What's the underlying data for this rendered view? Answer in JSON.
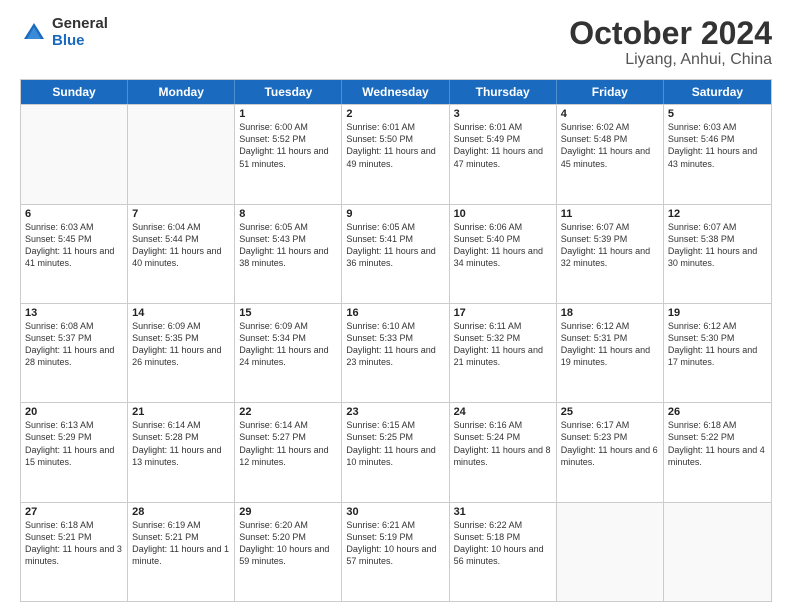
{
  "logo": {
    "general": "General",
    "blue": "Blue"
  },
  "header": {
    "month": "October 2024",
    "location": "Liyang, Anhui, China"
  },
  "weekdays": [
    "Sunday",
    "Monday",
    "Tuesday",
    "Wednesday",
    "Thursday",
    "Friday",
    "Saturday"
  ],
  "rows": [
    [
      {
        "day": "",
        "info": ""
      },
      {
        "day": "",
        "info": ""
      },
      {
        "day": "1",
        "info": "Sunrise: 6:00 AM\nSunset: 5:52 PM\nDaylight: 11 hours and 51 minutes."
      },
      {
        "day": "2",
        "info": "Sunrise: 6:01 AM\nSunset: 5:50 PM\nDaylight: 11 hours and 49 minutes."
      },
      {
        "day": "3",
        "info": "Sunrise: 6:01 AM\nSunset: 5:49 PM\nDaylight: 11 hours and 47 minutes."
      },
      {
        "day": "4",
        "info": "Sunrise: 6:02 AM\nSunset: 5:48 PM\nDaylight: 11 hours and 45 minutes."
      },
      {
        "day": "5",
        "info": "Sunrise: 6:03 AM\nSunset: 5:46 PM\nDaylight: 11 hours and 43 minutes."
      }
    ],
    [
      {
        "day": "6",
        "info": "Sunrise: 6:03 AM\nSunset: 5:45 PM\nDaylight: 11 hours and 41 minutes."
      },
      {
        "day": "7",
        "info": "Sunrise: 6:04 AM\nSunset: 5:44 PM\nDaylight: 11 hours and 40 minutes."
      },
      {
        "day": "8",
        "info": "Sunrise: 6:05 AM\nSunset: 5:43 PM\nDaylight: 11 hours and 38 minutes."
      },
      {
        "day": "9",
        "info": "Sunrise: 6:05 AM\nSunset: 5:41 PM\nDaylight: 11 hours and 36 minutes."
      },
      {
        "day": "10",
        "info": "Sunrise: 6:06 AM\nSunset: 5:40 PM\nDaylight: 11 hours and 34 minutes."
      },
      {
        "day": "11",
        "info": "Sunrise: 6:07 AM\nSunset: 5:39 PM\nDaylight: 11 hours and 32 minutes."
      },
      {
        "day": "12",
        "info": "Sunrise: 6:07 AM\nSunset: 5:38 PM\nDaylight: 11 hours and 30 minutes."
      }
    ],
    [
      {
        "day": "13",
        "info": "Sunrise: 6:08 AM\nSunset: 5:37 PM\nDaylight: 11 hours and 28 minutes."
      },
      {
        "day": "14",
        "info": "Sunrise: 6:09 AM\nSunset: 5:35 PM\nDaylight: 11 hours and 26 minutes."
      },
      {
        "day": "15",
        "info": "Sunrise: 6:09 AM\nSunset: 5:34 PM\nDaylight: 11 hours and 24 minutes."
      },
      {
        "day": "16",
        "info": "Sunrise: 6:10 AM\nSunset: 5:33 PM\nDaylight: 11 hours and 23 minutes."
      },
      {
        "day": "17",
        "info": "Sunrise: 6:11 AM\nSunset: 5:32 PM\nDaylight: 11 hours and 21 minutes."
      },
      {
        "day": "18",
        "info": "Sunrise: 6:12 AM\nSunset: 5:31 PM\nDaylight: 11 hours and 19 minutes."
      },
      {
        "day": "19",
        "info": "Sunrise: 6:12 AM\nSunset: 5:30 PM\nDaylight: 11 hours and 17 minutes."
      }
    ],
    [
      {
        "day": "20",
        "info": "Sunrise: 6:13 AM\nSunset: 5:29 PM\nDaylight: 11 hours and 15 minutes."
      },
      {
        "day": "21",
        "info": "Sunrise: 6:14 AM\nSunset: 5:28 PM\nDaylight: 11 hours and 13 minutes."
      },
      {
        "day": "22",
        "info": "Sunrise: 6:14 AM\nSunset: 5:27 PM\nDaylight: 11 hours and 12 minutes."
      },
      {
        "day": "23",
        "info": "Sunrise: 6:15 AM\nSunset: 5:25 PM\nDaylight: 11 hours and 10 minutes."
      },
      {
        "day": "24",
        "info": "Sunrise: 6:16 AM\nSunset: 5:24 PM\nDaylight: 11 hours and 8 minutes."
      },
      {
        "day": "25",
        "info": "Sunrise: 6:17 AM\nSunset: 5:23 PM\nDaylight: 11 hours and 6 minutes."
      },
      {
        "day": "26",
        "info": "Sunrise: 6:18 AM\nSunset: 5:22 PM\nDaylight: 11 hours and 4 minutes."
      }
    ],
    [
      {
        "day": "27",
        "info": "Sunrise: 6:18 AM\nSunset: 5:21 PM\nDaylight: 11 hours and 3 minutes."
      },
      {
        "day": "28",
        "info": "Sunrise: 6:19 AM\nSunset: 5:21 PM\nDaylight: 11 hours and 1 minute."
      },
      {
        "day": "29",
        "info": "Sunrise: 6:20 AM\nSunset: 5:20 PM\nDaylight: 10 hours and 59 minutes."
      },
      {
        "day": "30",
        "info": "Sunrise: 6:21 AM\nSunset: 5:19 PM\nDaylight: 10 hours and 57 minutes."
      },
      {
        "day": "31",
        "info": "Sunrise: 6:22 AM\nSunset: 5:18 PM\nDaylight: 10 hours and 56 minutes."
      },
      {
        "day": "",
        "info": ""
      },
      {
        "day": "",
        "info": ""
      }
    ]
  ]
}
